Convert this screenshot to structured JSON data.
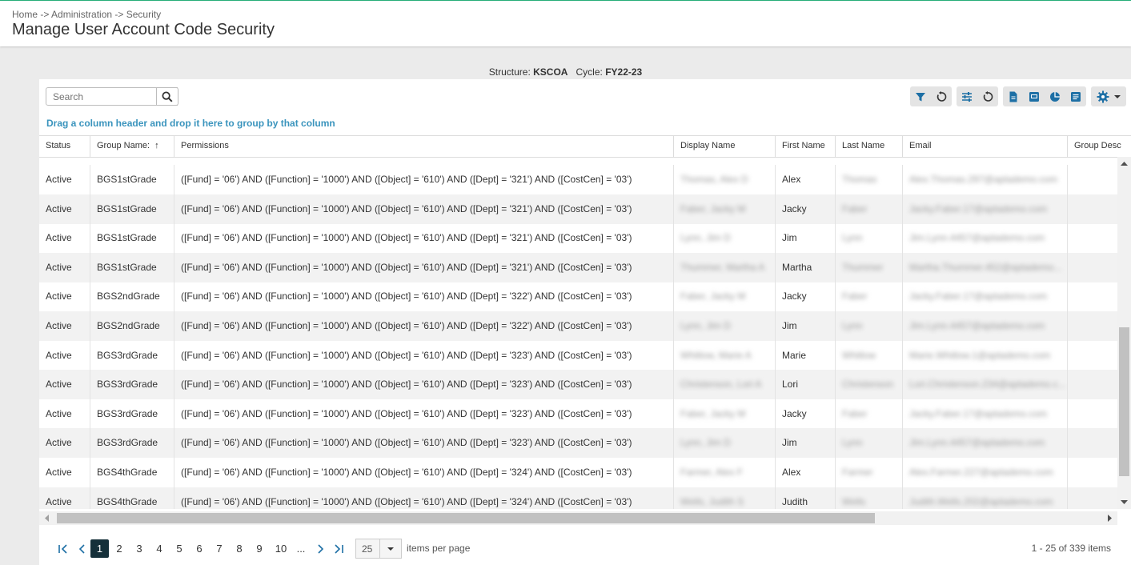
{
  "breadcrumb": "Home -> Administration -> Security",
  "page_title": "Manage User Account Code Security",
  "context": {
    "structure_label": "Structure:",
    "structure_value": "KSCOA",
    "cycle_label": "Cycle:",
    "cycle_value": "FY22-23"
  },
  "search": {
    "placeholder": "Search"
  },
  "group_hint": "Drag a column header and drop it here to group by that column",
  "columns": [
    "Status",
    "Group Name:",
    "Permissions",
    "Display Name",
    "First Name",
    "Last Name",
    "Email",
    "Group Desc"
  ],
  "sort_indicator": "↑",
  "rows": [
    {
      "status": "Active",
      "group": "BGS1stGrade",
      "permissions": "([Fund] = '06') AND ([Function] = '1000') AND ([Object] = '610') AND ([Dept] = '321') AND ([CostCen] = '03')",
      "display": "Thomas, Alex D",
      "first": "Alex",
      "last": "Thomas",
      "email": "Alex.Thomas.297@aptademo.com"
    },
    {
      "status": "Active",
      "group": "BGS1stGrade",
      "permissions": "([Fund] = '06') AND ([Function] = '1000') AND ([Object] = '610') AND ([Dept] = '321') AND ([CostCen] = '03')",
      "display": "Faber, Jacky M",
      "first": "Jacky",
      "last": "Faber",
      "email": "Jacky.Faber.17@aptademo.com"
    },
    {
      "status": "Active",
      "group": "BGS1stGrade",
      "permissions": "([Fund] = '06') AND ([Function] = '1000') AND ([Object] = '610') AND ([Dept] = '321') AND ([CostCen] = '03')",
      "display": "Lynn, Jim D",
      "first": "Jim",
      "last": "Lynn",
      "email": "Jim.Lynn.4457@aptademo.com"
    },
    {
      "status": "Active",
      "group": "BGS1stGrade",
      "permissions": "([Fund] = '06') AND ([Function] = '1000') AND ([Object] = '610') AND ([Dept] = '321') AND ([CostCen] = '03')",
      "display": "Thummer, Martha A",
      "first": "Martha",
      "last": "Thummer",
      "email": "Martha.Thummer.452@aptademo..."
    },
    {
      "status": "Active",
      "group": "BGS2ndGrade",
      "permissions": "([Fund] = '06') AND ([Function] = '1000') AND ([Object] = '610') AND ([Dept] = '322') AND ([CostCen] = '03')",
      "display": "Faber, Jacky M",
      "first": "Jacky",
      "last": "Faber",
      "email": "Jacky.Faber.17@aptademo.com"
    },
    {
      "status": "Active",
      "group": "BGS2ndGrade",
      "permissions": "([Fund] = '06') AND ([Function] = '1000') AND ([Object] = '610') AND ([Dept] = '322') AND ([CostCen] = '03')",
      "display": "Lynn, Jim D",
      "first": "Jim",
      "last": "Lynn",
      "email": "Jim.Lynn.4457@aptademo.com"
    },
    {
      "status": "Active",
      "group": "BGS3rdGrade",
      "permissions": "([Fund] = '06') AND ([Function] = '1000') AND ([Object] = '610') AND ([Dept] = '323') AND ([CostCen] = '03')",
      "display": "Whitlow, Marie A",
      "first": "Marie",
      "last": "Whitlow",
      "email": "Marie.Whitlow.1@aptademo.com"
    },
    {
      "status": "Active",
      "group": "BGS3rdGrade",
      "permissions": "([Fund] = '06') AND ([Function] = '1000') AND ([Object] = '610') AND ([Dept] = '323') AND ([CostCen] = '03')",
      "display": "Christenson, Lori A",
      "first": "Lori",
      "last": "Christenson",
      "email": "Lori.Christenson.234@aptademo.c..."
    },
    {
      "status": "Active",
      "group": "BGS3rdGrade",
      "permissions": "([Fund] = '06') AND ([Function] = '1000') AND ([Object] = '610') AND ([Dept] = '323') AND ([CostCen] = '03')",
      "display": "Faber, Jacky M",
      "first": "Jacky",
      "last": "Faber",
      "email": "Jacky.Faber.17@aptademo.com"
    },
    {
      "status": "Active",
      "group": "BGS3rdGrade",
      "permissions": "([Fund] = '06') AND ([Function] = '1000') AND ([Object] = '610') AND ([Dept] = '323') AND ([CostCen] = '03')",
      "display": "Lynn, Jim D",
      "first": "Jim",
      "last": "Lynn",
      "email": "Jim.Lynn.4457@aptademo.com"
    },
    {
      "status": "Active",
      "group": "BGS4thGrade",
      "permissions": "([Fund] = '06') AND ([Function] = '1000') AND ([Object] = '610') AND ([Dept] = '324') AND ([CostCen] = '03')",
      "display": "Farmer, Alex F",
      "first": "Alex",
      "last": "Farmer",
      "email": "Alex.Farmer.227@aptademo.com"
    },
    {
      "status": "Active",
      "group": "BGS4thGrade",
      "permissions": "([Fund] = '06') AND ([Function] = '1000') AND ([Object] = '610') AND ([Dept] = '324') AND ([CostCen] = '03')",
      "display": "Wells, Judith S",
      "first": "Judith",
      "last": "Wells",
      "email": "Judith.Wells.202@aptademo.com"
    }
  ],
  "pager": {
    "pages": [
      "1",
      "2",
      "3",
      "4",
      "5",
      "6",
      "7",
      "8",
      "9",
      "10",
      "..."
    ],
    "current_page": "1",
    "page_size": "25",
    "items_per_page_label": "items per page",
    "info": "1 - 25 of 339 items"
  },
  "colors": {
    "accent": "#1d6fa5",
    "toolbar_icon": "#1d6fa5",
    "hint": "#3a94bd",
    "active_page": "#15303a"
  }
}
